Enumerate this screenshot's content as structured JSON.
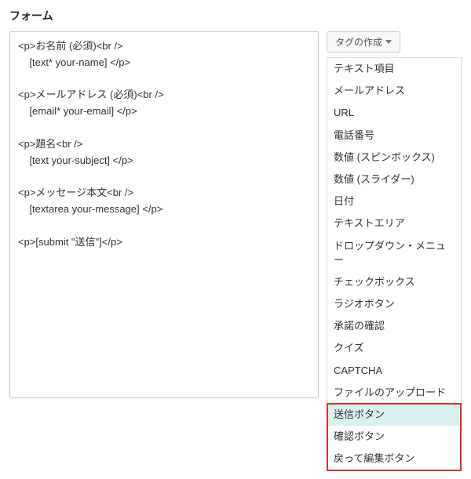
{
  "section_title": "フォーム",
  "form_code": "<p>お名前 (必須)<br />\n    [text* your-name] </p>\n\n<p>メールアドレス (必須)<br />\n    [email* your-email] </p>\n\n<p>題名<br />\n    [text your-subject] </p>\n\n<p>メッセージ本文<br />\n    [textarea your-message] </p>\n\n<p>[submit \"送信\"]</p>",
  "tag_button_label": "タグの作成",
  "tag_items": [
    {
      "label": "テキスト項目",
      "selected": false,
      "highlight": false
    },
    {
      "label": "メールアドレス",
      "selected": false,
      "highlight": false
    },
    {
      "label": "URL",
      "selected": false,
      "highlight": false
    },
    {
      "label": "電話番号",
      "selected": false,
      "highlight": false
    },
    {
      "label": "数値 (スピンボックス)",
      "selected": false,
      "highlight": false
    },
    {
      "label": "数値 (スライダー)",
      "selected": false,
      "highlight": false
    },
    {
      "label": "日付",
      "selected": false,
      "highlight": false
    },
    {
      "label": "テキストエリア",
      "selected": false,
      "highlight": false
    },
    {
      "label": "ドロップダウン・メニュー",
      "selected": false,
      "highlight": false
    },
    {
      "label": "チェックボックス",
      "selected": false,
      "highlight": false
    },
    {
      "label": "ラジオボタン",
      "selected": false,
      "highlight": false
    },
    {
      "label": "承諾の確認",
      "selected": false,
      "highlight": false
    },
    {
      "label": "クイズ",
      "selected": false,
      "highlight": false
    },
    {
      "label": "CAPTCHA",
      "selected": false,
      "highlight": false
    },
    {
      "label": "ファイルのアップロード",
      "selected": false,
      "highlight": false
    },
    {
      "label": "送信ボタン",
      "selected": true,
      "highlight": true
    },
    {
      "label": "確認ボタン",
      "selected": false,
      "highlight": true
    },
    {
      "label": "戻って編集ボタン",
      "selected": false,
      "highlight": true
    }
  ]
}
